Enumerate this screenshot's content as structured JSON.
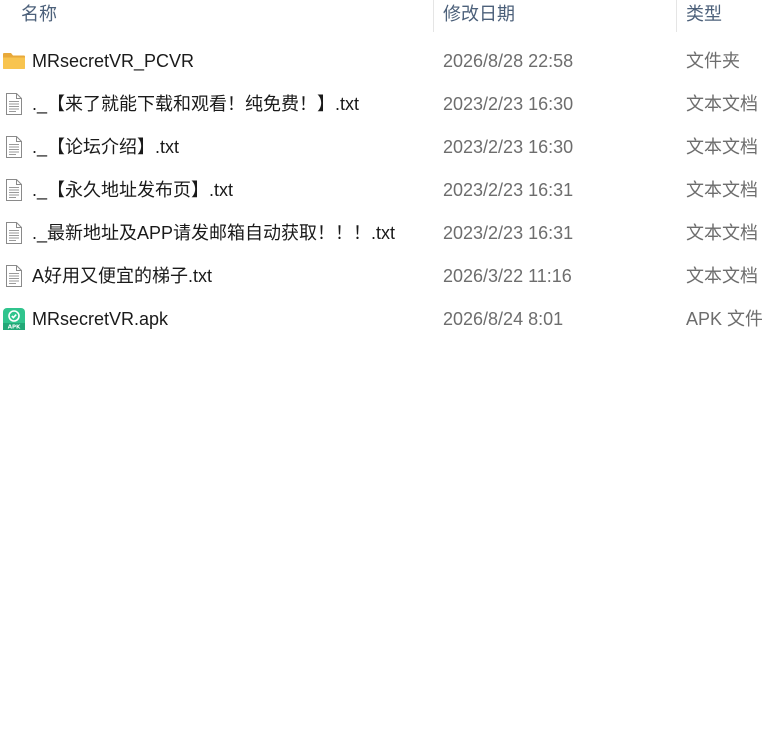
{
  "columns": {
    "name": "名称",
    "date": "修改日期",
    "type": "类型"
  },
  "colors": {
    "header_text": "#4c607a",
    "name_text": "#1a1a1a",
    "meta_text": "#6d6d6d",
    "folder_yellow": "#f8c44f",
    "apk_green": "#30c48d"
  },
  "files": [
    {
      "icon": "folder-icon",
      "name": "MRsecretVR_PCVR",
      "date": "2026/8/28 22:58",
      "type": "文件夹"
    },
    {
      "icon": "text-file-icon",
      "name": "._【来了就能下载和观看！纯免费！】.txt",
      "date": "2023/2/23 16:30",
      "type": "文本文档"
    },
    {
      "icon": "text-file-icon",
      "name": "._【论坛介绍】.txt",
      "date": "2023/2/23 16:30",
      "type": "文本文档"
    },
    {
      "icon": "text-file-icon",
      "name": "._【永久地址发布页】.txt",
      "date": "2023/2/23 16:31",
      "type": "文本文档"
    },
    {
      "icon": "text-file-icon",
      "name": "._最新地址及APP请发邮箱自动获取！！！.txt",
      "date": "2023/2/23 16:31",
      "type": "文本文档"
    },
    {
      "icon": "text-file-icon",
      "name": "A好用又便宜的梯子.txt",
      "date": "2026/3/22 11:16",
      "type": "文本文档"
    },
    {
      "icon": "apk-file-icon",
      "name": "MRsecretVR.apk",
      "date": "2026/8/24 8:01",
      "type": "APK 文件",
      "icon_label": "APK"
    }
  ]
}
